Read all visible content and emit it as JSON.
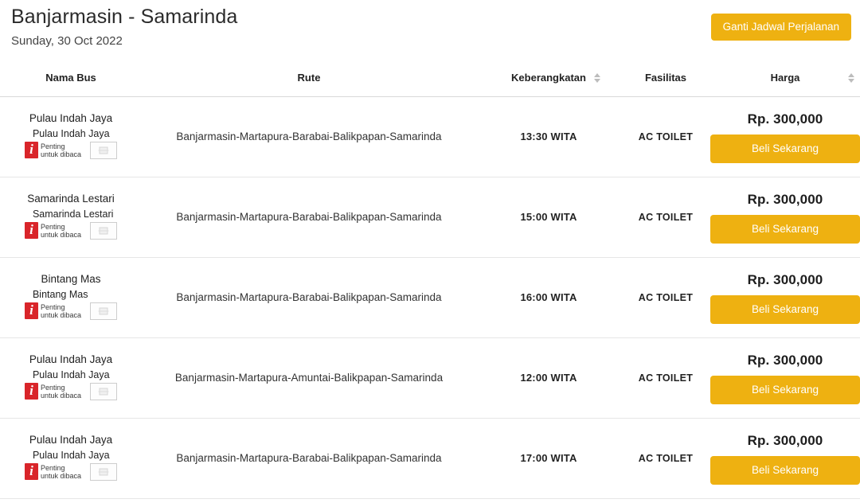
{
  "header": {
    "title": "Banjarmasin - Samarinda",
    "date": "Sunday, 30 Oct 2022",
    "change_schedule_label": "Ganti Jadwal Perjalanan"
  },
  "table": {
    "columns": [
      {
        "key": "bus",
        "label": "Nama Bus",
        "sortable": false
      },
      {
        "key": "rute",
        "label": "Rute",
        "sortable": false
      },
      {
        "key": "dep",
        "label": "Keberangkatan",
        "sortable": true
      },
      {
        "key": "fas",
        "label": "Fasilitas",
        "sortable": false
      },
      {
        "key": "price",
        "label": "Harga",
        "sortable": true
      }
    ],
    "broken_image_badge": {
      "line1": "Penting",
      "line2": "untuk dibaca",
      "info_icon": "info-icon",
      "thumb_icon": "broken-image-icon"
    },
    "buy_label": "Beli Sekarang",
    "rows": [
      {
        "bus": "Pulau Indah Jaya",
        "alt": "Pulau Indah Jaya",
        "rute": "Banjarmasin-Martapura-Barabai-Balikpapan-Samarinda",
        "dep": "13:30 WITA",
        "fas": "AC TOILET",
        "price": "Rp. 300,000"
      },
      {
        "bus": "Samarinda Lestari",
        "alt": "Samarinda Lestari",
        "rute": "Banjarmasin-Martapura-Barabai-Balikpapan-Samarinda",
        "dep": "15:00 WITA",
        "fas": "AC TOILET",
        "price": "Rp. 300,000"
      },
      {
        "bus": "Bintang Mas",
        "alt": "Bintang Mas",
        "rute": "Banjarmasin-Martapura-Barabai-Balikpapan-Samarinda",
        "dep": "16:00 WITA",
        "fas": "AC TOILET",
        "price": "Rp. 300,000"
      },
      {
        "bus": "Pulau Indah Jaya",
        "alt": "Pulau Indah Jaya",
        "rute": "Banjarmasin-Martapura-Amuntai-Balikpapan-Samarinda",
        "dep": "12:00 WITA",
        "fas": "AC TOILET",
        "price": "Rp. 300,000"
      },
      {
        "bus": "Pulau Indah Jaya",
        "alt": "Pulau Indah Jaya",
        "rute": "Banjarmasin-Martapura-Barabai-Balikpapan-Samarinda",
        "dep": "17:00 WITA",
        "fas": "AC TOILET",
        "price": "Rp. 300,000"
      }
    ]
  },
  "colors": {
    "accent": "#eeb111",
    "info_red": "#d9252a",
    "text": "#222222"
  }
}
